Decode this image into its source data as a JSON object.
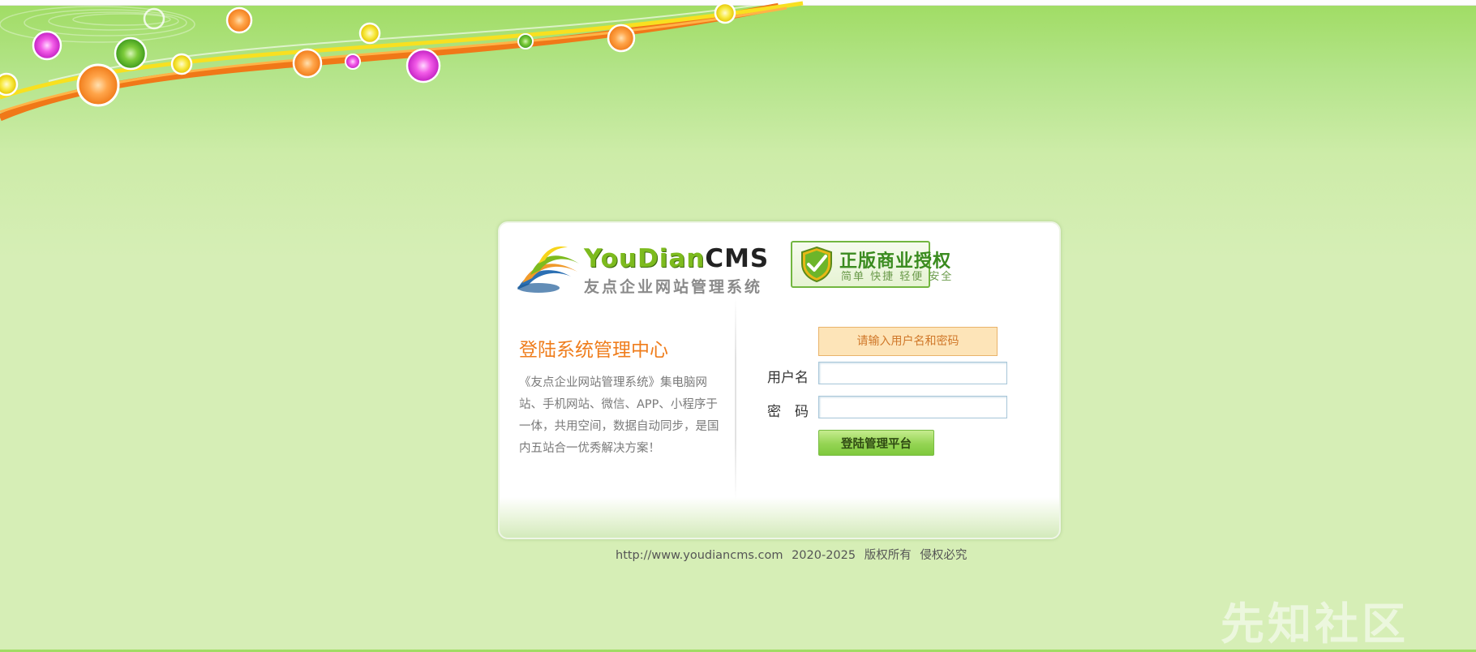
{
  "brand": {
    "logo_en_main": "YouDian",
    "logo_en_cms": "CMS",
    "logo_cn": "友点企业网站管理系统",
    "auth_title": "正版商业授权",
    "auth_sub": "简单 快捷 轻便 安全"
  },
  "intro": {
    "title": "登陆系统管理中心",
    "description": "《友点企业网站管理系统》集电脑网站、手机网站、微信、APP、小程序于一体，共用空间，数据自动同步，是国内五站合一优秀解决方案！"
  },
  "login": {
    "hint": "请输入用户名和密码",
    "username_label": "用户名",
    "password_label": "密　码",
    "username_value": "",
    "password_value": "",
    "submit_label": "登陆管理平台"
  },
  "footer": {
    "url": "http://www.youdiancms.com",
    "years": "2020-2025",
    "rights": "版权所有",
    "infringe": "侵权必究"
  },
  "watermark": "先知社区",
  "colors": {
    "accent_orange": "#ef7d1c",
    "brand_green": "#7dbb1e",
    "hint_bg": "#fde4b8",
    "button_green": "#94d453"
  }
}
